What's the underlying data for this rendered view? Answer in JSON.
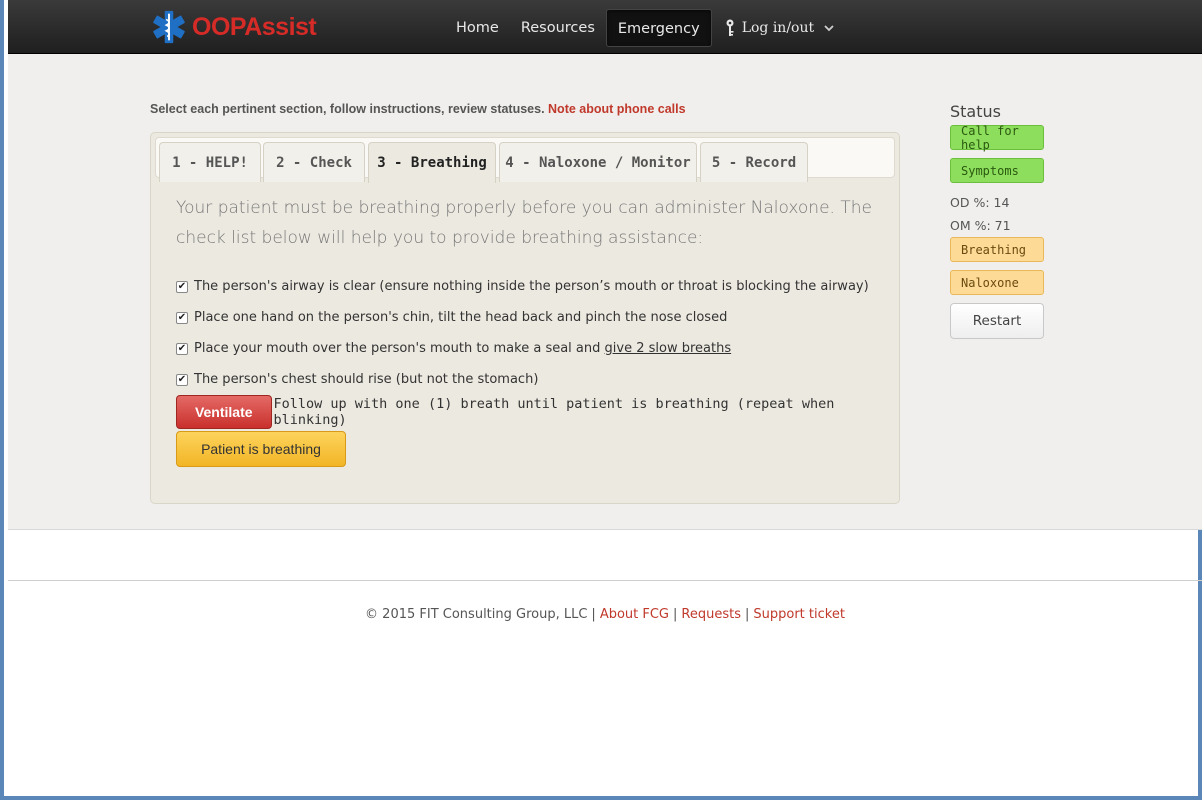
{
  "brand": {
    "name": "OOPAssist"
  },
  "nav": {
    "home": "Home",
    "resources": "Resources",
    "emergency": "Emergency",
    "login": "Log in/out"
  },
  "instructions": {
    "text": "Select each pertinent section, follow instructions, review statuses. ",
    "link": "Note about phone calls"
  },
  "tabs": [
    {
      "label": "1 - HELP!"
    },
    {
      "label": "2 - Check"
    },
    {
      "label": "3 - Breathing",
      "active": true
    },
    {
      "label": "4 - Naloxone / Monitor"
    },
    {
      "label": "5 - Record"
    }
  ],
  "content": {
    "intro": "Your patient must be breathing properly before you can administer Naloxone. The check list below will help you to provide breathing assistance:",
    "checklist": [
      {
        "text": "The person's airway is clear (ensure nothing inside the person’s mouth or throat is blocking the airway)",
        "checked": true
      },
      {
        "text": "Place one hand on the person's chin, tilt the head back and pinch the nose closed",
        "checked": true
      },
      {
        "text": "Place your mouth over the person's mouth to make a seal and ",
        "link": "give 2 slow breaths",
        "checked": true
      },
      {
        "text": "The person's chest should rise (but not the stomach)",
        "checked": true
      }
    ],
    "ventilate_label": "Ventilate",
    "ventilate_text": "Follow up with one (1) breath until patient is breathing (repeat when blinking)",
    "breathing_label": "Patient is breathing"
  },
  "status": {
    "title": "Status",
    "call_for_help": "Call for help",
    "symptoms": "Symptoms",
    "od": "OD %: 14",
    "om": "OM %: 71",
    "breathing": "Breathing",
    "naloxone": "Naloxone",
    "restart": "Restart",
    "colors": {
      "done": "#8ede5d",
      "pending": "#fddb96"
    }
  },
  "footer": {
    "copyright": "© 2015 FIT Consulting Group, LLC",
    "about": "About FCG",
    "requests": "Requests",
    "support": "Support ticket"
  }
}
